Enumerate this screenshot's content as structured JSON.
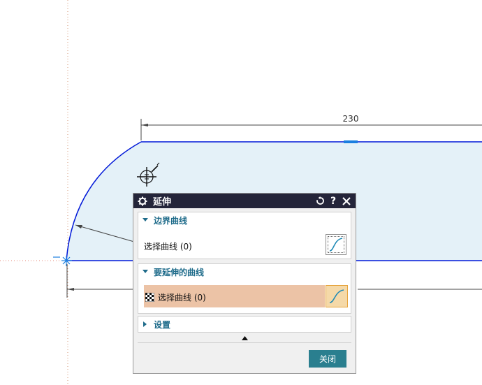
{
  "canvas": {
    "dimension_value": "230",
    "fill_color": "#e4f1f8",
    "curve_color": "#0018d8"
  },
  "dialog": {
    "title": "延伸",
    "title_icons": [
      "gear-icon",
      "reset-icon",
      "help-icon",
      "close-icon"
    ],
    "groups": [
      {
        "title": "边界曲线",
        "expanded": true,
        "select_label": "选择曲线 (0)",
        "icon": "curve-select-icon"
      },
      {
        "title": "要延伸的曲线",
        "expanded": true,
        "select_label": "选择曲线 (0)",
        "icon": "curve-select-icon",
        "active": true
      },
      {
        "title": "设置",
        "expanded": false
      }
    ],
    "close_label": "关闭",
    "accent": "#2a7f8f",
    "active_row_color": "#ecc3a6"
  }
}
